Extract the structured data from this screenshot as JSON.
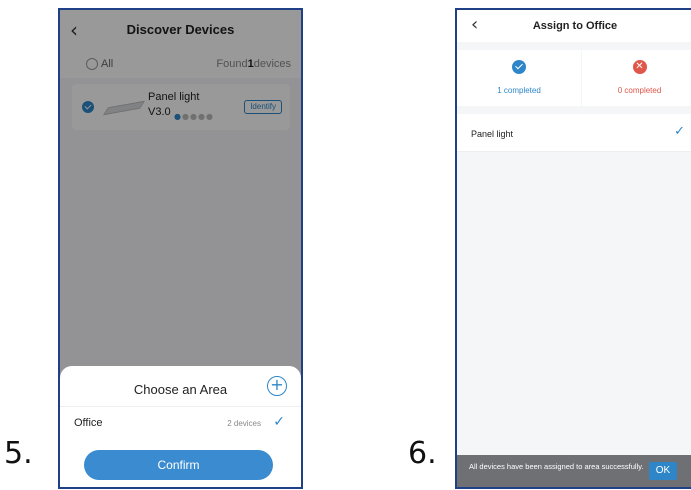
{
  "steps": [
    "5.",
    "6."
  ],
  "discover": {
    "title": "Discover Devices",
    "all_label": "All",
    "found_prefix": "Found",
    "found_count": "1",
    "found_suffix": "devices",
    "device": {
      "name": "Panel light",
      "version": "V3.0",
      "signal_level": 1,
      "signal_max": 5,
      "identify_label": "Identify"
    }
  },
  "area_sheet": {
    "title": "Choose an Area",
    "area_name": "Office",
    "area_count": "2 devices",
    "confirm_label": "Confirm"
  },
  "assign": {
    "title": "Assign to Office",
    "completed_label": "1 completed",
    "failed_label": "0 completed",
    "device_name": "Panel light",
    "toast_text": "All devices have been assigned to area successfully.",
    "ok_label": "OK"
  },
  "colors": {
    "accent": "#2e86c9",
    "error": "#e0564a",
    "frame": "#1f3f86"
  },
  "icons": [
    "back-chevron-icon",
    "check-circle-icon",
    "add-circle-icon",
    "checkmark-icon",
    "error-circle-icon"
  ]
}
